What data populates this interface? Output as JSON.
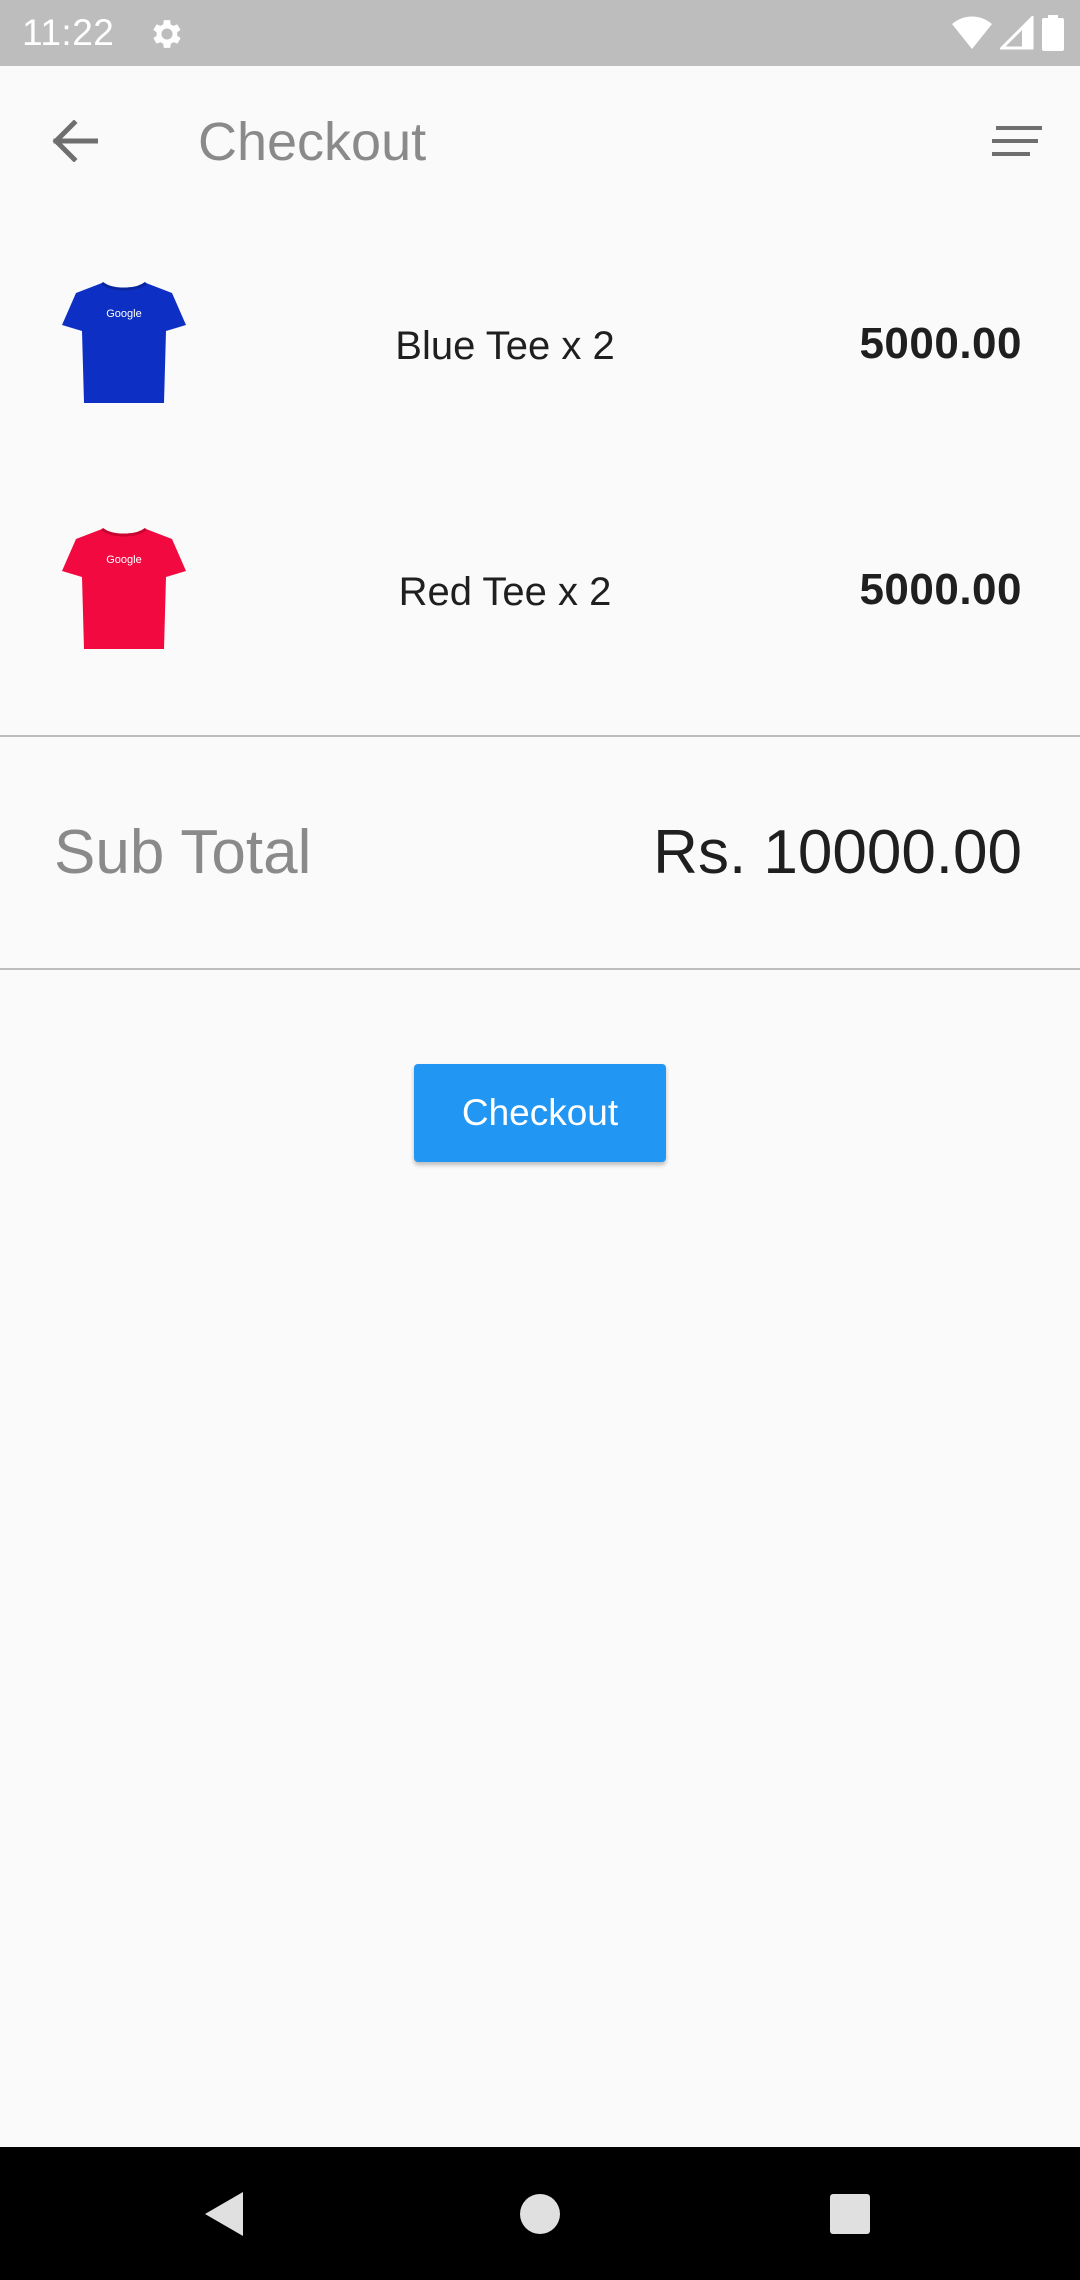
{
  "status_bar": {
    "time": "11:22",
    "icons": [
      "settings-gear-icon",
      "wifi-icon",
      "cellular-signal-icon",
      "battery-icon"
    ]
  },
  "app_bar": {
    "title": "Checkout",
    "back_icon": "arrow-back-icon",
    "menu_icon": "sort-menu-icon"
  },
  "cart": {
    "items": [
      {
        "name": "Blue Tee x 2",
        "price": "5000.00",
        "shirt_color": "#0d2fc4",
        "logo_text": "Google"
      },
      {
        "name": "Red Tee x 2",
        "price": "5000.00",
        "shirt_color": "#f2093f",
        "logo_text": "Google"
      }
    ]
  },
  "summary": {
    "label": "Sub Total",
    "value": "Rs. 10000.00"
  },
  "actions": {
    "checkout_label": "Checkout",
    "accent_color": "#2196f3"
  },
  "nav_bar": {
    "icons": [
      "nav-back-icon",
      "nav-home-icon",
      "nav-recents-icon"
    ]
  }
}
